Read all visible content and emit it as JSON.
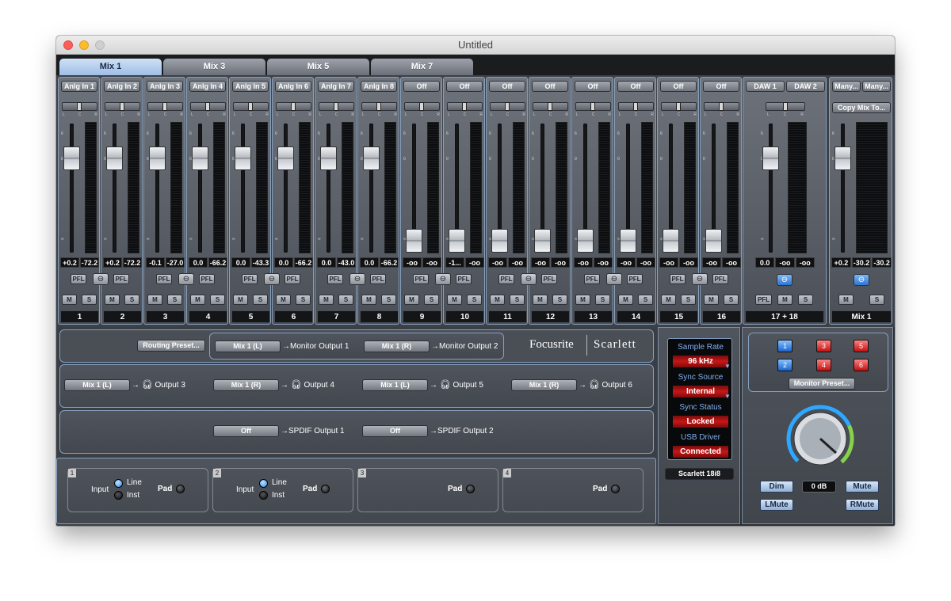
{
  "window": {
    "title": "Untitled"
  },
  "tabs": [
    {
      "label": "Mix 1"
    },
    {
      "label": "Mix 3"
    },
    {
      "label": "Mix 5"
    },
    {
      "label": "Mix 7"
    }
  ],
  "strips": [
    {
      "source": "Anlg In 1",
      "vals": [
        "+0.2",
        "-72.2"
      ],
      "number": "1",
      "level": 0.78
    },
    {
      "source": "Anlg In 2",
      "vals": [
        "+0.2",
        "-72.2"
      ],
      "number": "2",
      "level": 0.78
    },
    {
      "source": "Anlg In 3",
      "vals": [
        "-0.1",
        "-27.0"
      ],
      "number": "3",
      "level": 0.78
    },
    {
      "source": "Anlg In 4",
      "vals": [
        "0.0",
        "-66.2"
      ],
      "number": "4",
      "level": 0.78
    },
    {
      "source": "Anlg In 5",
      "vals": [
        "0.0",
        "-43.3"
      ],
      "number": "5",
      "level": 0.78
    },
    {
      "source": "Anlg In 6",
      "vals": [
        "0.0",
        "-66.2"
      ],
      "number": "6",
      "level": 0.78
    },
    {
      "source": "Anlg In 7",
      "vals": [
        "0.0",
        "-43.0"
      ],
      "number": "7",
      "level": 0.78
    },
    {
      "source": "Anlg In 8",
      "vals": [
        "0.0",
        "-66.2"
      ],
      "number": "8",
      "level": 0.78
    },
    {
      "source": "Off",
      "vals": [
        "-oo",
        "-oo"
      ],
      "number": "9",
      "level": 0.0
    },
    {
      "source": "Off",
      "vals": [
        "-1...",
        "-oo"
      ],
      "number": "10",
      "level": 0.0
    },
    {
      "source": "Off",
      "vals": [
        "-oo",
        "-oo"
      ],
      "number": "11",
      "level": 0.0
    },
    {
      "source": "Off",
      "vals": [
        "-oo",
        "-oo"
      ],
      "number": "12",
      "level": 0.0
    },
    {
      "source": "Off",
      "vals": [
        "-oo",
        "-oo"
      ],
      "number": "13",
      "level": 0.0
    },
    {
      "source": "Off",
      "vals": [
        "-oo",
        "-oo"
      ],
      "number": "14",
      "level": 0.0
    },
    {
      "source": "Off",
      "vals": [
        "-oo",
        "-oo"
      ],
      "number": "15",
      "level": 0.0
    },
    {
      "source": "Off",
      "vals": [
        "-oo",
        "-oo"
      ],
      "number": "16",
      "level": 0.0
    }
  ],
  "daw": {
    "source1": "DAW 1",
    "source2": "DAW 2",
    "vals": [
      "0.0",
      "-oo",
      "-oo"
    ],
    "number": "17 + 18",
    "level": 0.78
  },
  "mixmaster": {
    "source1": "Many...",
    "source2": "Many...",
    "copy": "Copy Mix To...",
    "vals": [
      "+0.2",
      "-30.2",
      "-30.2"
    ],
    "number": "Mix 1",
    "level": 0.78
  },
  "buttons": {
    "pfl": "PFL",
    "mute": "M",
    "solo": "S"
  },
  "scale": {
    "top": "6",
    "zero": "0",
    "inf": "∞"
  },
  "pan": {
    "l": "L",
    "c": "C",
    "r": "R"
  },
  "routing": {
    "preset": "Routing Preset...",
    "brand1": "Focusrite",
    "brand2": "Scarlett",
    "row1": [
      {
        "src": "Mix 1 (L)",
        "dest": "Monitor Output 1"
      },
      {
        "src": "Mix 1 (R)",
        "dest": "Monitor Output 2"
      }
    ],
    "row2": [
      {
        "src": "Mix 1 (L)",
        "dest": "Output 3"
      },
      {
        "src": "Mix 1 (R)",
        "dest": "Output 4"
      },
      {
        "src": "Mix 1 (L)",
        "dest": "Output 5"
      },
      {
        "src": "Mix 1 (R)",
        "dest": "Output 6"
      }
    ],
    "row3": [
      {
        "src": "Off",
        "dest": "SPDIF Output 1"
      },
      {
        "src": "Off",
        "dest": "SPDIF Output 2"
      }
    ]
  },
  "inputs": [
    {
      "num": "1",
      "input": "Input",
      "line": "Line",
      "inst": "Inst",
      "pad": "Pad"
    },
    {
      "num": "2",
      "input": "Input",
      "line": "Line",
      "inst": "Inst",
      "pad": "Pad"
    },
    {
      "num": "3",
      "pad": "Pad"
    },
    {
      "num": "4",
      "pad": "Pad"
    }
  ],
  "status": {
    "sample_rate_label": "Sample Rate",
    "sample_rate": "96 kHz",
    "sync_source_label": "Sync Source",
    "sync_source": "Internal",
    "sync_status_label": "Sync Status",
    "sync_status": "Locked",
    "usb_label": "USB  Driver",
    "usb": "Connected",
    "device": "Scarlett 18i8"
  },
  "monitor": {
    "buttons": [
      {
        "label": "1",
        "color": "blue"
      },
      {
        "label": "2",
        "color": "blue"
      },
      {
        "label": "3",
        "color": "red"
      },
      {
        "label": "4",
        "color": "red"
      },
      {
        "label": "5",
        "color": "red"
      },
      {
        "label": "6",
        "color": "red"
      }
    ],
    "preset": "Monitor Preset...",
    "dim": "Dim",
    "level": "0 dB",
    "mute": "Mute",
    "lmute": "LMute",
    "rmute": "RMute"
  },
  "colors": {
    "accent": "#2f76d2",
    "status_red": "#c81616",
    "knob_ring": "#2ea8ff"
  }
}
